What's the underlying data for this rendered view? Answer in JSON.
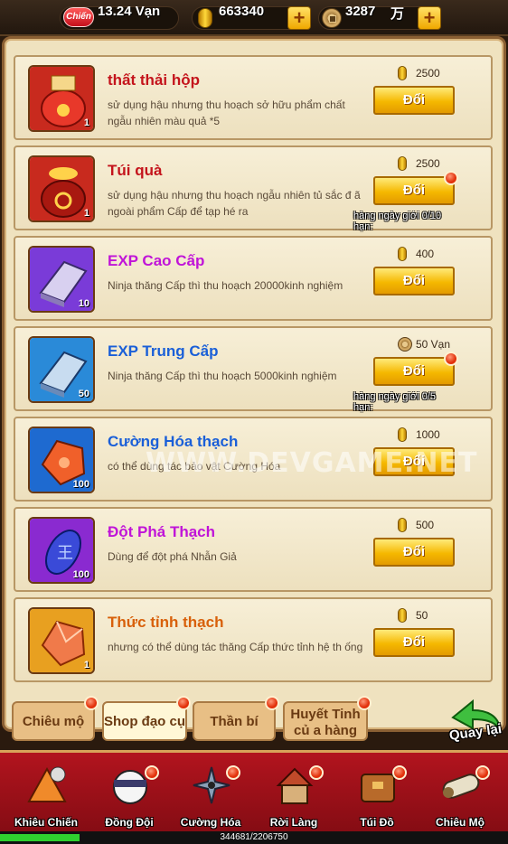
{
  "topbar": {
    "chien_badge": "Chiến",
    "power": "13.24 Vạn",
    "gold": "663340",
    "copper": "3287",
    "copper_unit": "万"
  },
  "items": [
    {
      "name": "thất thải hộp",
      "name_color": "#c4141c",
      "desc": "sử dụng hậu nhưng thu hoạch sở hữu phẩm chất ngẫu nhiên màu quả *5",
      "price": "2500",
      "currency": "gold-icon",
      "qty": "1",
      "button": "Đổi",
      "dot": false,
      "limit": "",
      "icon": "red-bag"
    },
    {
      "name": "Túi quà",
      "name_color": "#c4141c",
      "desc": "sử dụng hậu nhưng thu hoạch ngẫu nhiên tủ sắc đ ã ngoài phẩm  Cấp để tạp hé ra",
      "price": "2500",
      "currency": "gold-icon",
      "qty": "1",
      "button": "Đổi",
      "dot": true,
      "limit": "hàng ngày giới 0/10\nhạn:",
      "icon": "gift-bag"
    },
    {
      "name": "EXP Cao Cấp",
      "name_color": "#c014d8",
      "desc": "Ninja thăng  Cấp thì thu hoạch 20000kinh nghiệm",
      "price": "400",
      "currency": "gold-icon",
      "qty": "10",
      "button": "Đổi",
      "dot": false,
      "limit": "",
      "icon": "purple-book"
    },
    {
      "name": "EXP Trung Cấp",
      "name_color": "#1a5fd8",
      "desc": "Ninja thăng  Cấp thì thu hoạch 5000kinh nghiệm",
      "price": "50 Vạn",
      "currency": "copper-icon",
      "qty": "50",
      "button": "Đổi",
      "dot": true,
      "limit": "hàng ngày giới 0/5\nhạn:",
      "icon": "blue-book"
    },
    {
      "name": "Cường Hóa thạch",
      "name_color": "#1a5fd8",
      "desc": "có thể dùng tác bảo vật Cường Hóa",
      "price": "1000",
      "currency": "gold-icon",
      "qty": "100",
      "button": "Đổi",
      "dot": false,
      "limit": "",
      "icon": "orange-stone"
    },
    {
      "name": "Đột Phá Thạch",
      "name_color": "#c014d8",
      "desc": "Dùng để đột phá Nhẫn Giả",
      "price": "500",
      "currency": "gold-icon",
      "qty": "100",
      "button": "Đổi",
      "dot": false,
      "limit": "",
      "icon": "blue-gem"
    },
    {
      "name": "Thức tỉnh thạch",
      "name_color": "#d8600a",
      "desc": "nhưng có thể dùng tác thăng  Cấp thức tỉnh hệ th ống",
      "price": "50",
      "currency": "gold-icon",
      "qty": "1",
      "button": "Đổi",
      "dot": false,
      "limit": "",
      "icon": "crystal-stone"
    }
  ],
  "tabs": [
    {
      "label": "Chiêu mộ",
      "active": false
    },
    {
      "label": "Shop đạo cụ",
      "active": true
    },
    {
      "label": "Thần bí",
      "active": false
    },
    {
      "label": "Huyết Tinh củ a hàng",
      "active": false
    }
  ],
  "back_label": "Quay lại",
  "watermark": "WWW.DEVGAME.NET",
  "nav": [
    {
      "label": "Khiêu Chiến",
      "icon": "battle-icon",
      "dot": false
    },
    {
      "label": "Đồng Đội",
      "icon": "ninja-icon",
      "dot": true
    },
    {
      "label": "Cường Hóa",
      "icon": "shuriken-icon",
      "dot": true
    },
    {
      "label": "Rời Làng",
      "icon": "village-icon",
      "dot": true
    },
    {
      "label": "Túi Đồ",
      "icon": "bag-icon",
      "dot": true
    },
    {
      "label": "Chiêu Mộ",
      "icon": "scroll-icon",
      "dot": true
    }
  ],
  "xp": {
    "text": "344681/2206750",
    "progress": 0.156
  },
  "colors": {
    "accent_gold": "#f5b800",
    "panel_bg": "#efe2bf",
    "nav_red": "#b2141e"
  }
}
